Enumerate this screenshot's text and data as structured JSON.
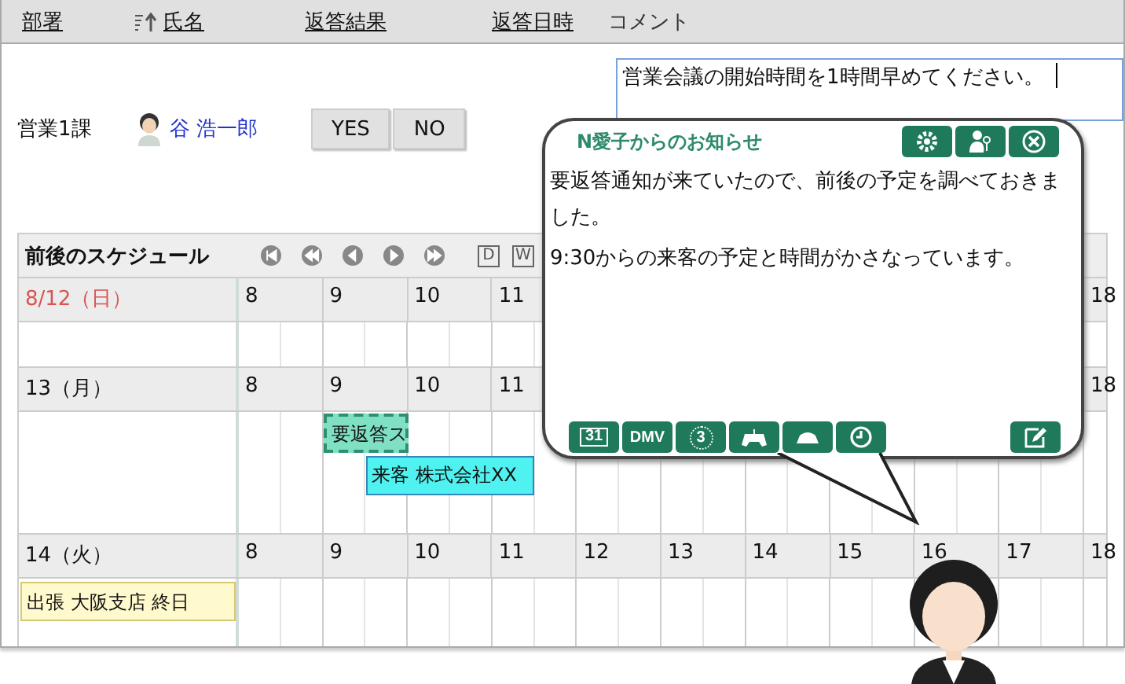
{
  "header_columns": [
    {
      "label": "部署",
      "kind": "link"
    },
    {
      "label": "氏名",
      "kind": "sorted"
    },
    {
      "label": "返答結果",
      "kind": "link"
    },
    {
      "label": "返答日時",
      "kind": "link"
    },
    {
      "label": "コメント",
      "kind": "plain"
    }
  ],
  "response_row": {
    "department": "営業1課",
    "name": "谷 浩一郎",
    "buttons": [
      "YES",
      "NO"
    ],
    "comment": "営業会議の開始時間を1時間早めてください。"
  },
  "schedule": {
    "title": "前後のスケジュール",
    "nav": [
      {
        "kind": "first"
      },
      {
        "kind": "fast-back"
      },
      {
        "kind": "back"
      },
      {
        "kind": "forward"
      },
      {
        "kind": "fast-forward"
      }
    ],
    "views": [
      {
        "label": "D"
      },
      {
        "label": "W"
      }
    ],
    "days": [
      {
        "label": "8/12（日）",
        "holiday": true,
        "hours": [
          "8",
          "9",
          "10",
          "11",
          "18"
        ]
      },
      {
        "label": "13（月）",
        "holiday": false,
        "hours": [
          "8",
          "9",
          "10",
          "11",
          "18"
        ],
        "events": [
          {
            "label": "要返答ス",
            "kind": "pending"
          },
          {
            "label": "来客 株式会社XX",
            "kind": "visitor"
          }
        ]
      },
      {
        "label": "14（火）",
        "holiday": false,
        "hours": [
          "8",
          "9",
          "10",
          "11",
          "12",
          "13",
          "14",
          "15",
          "16",
          "17",
          "18"
        ],
        "allday": [
          "出張 大阪支店 終日"
        ]
      }
    ]
  },
  "notice": {
    "title": "N愛子からのお知らせ",
    "header_buttons": [
      {
        "kind": "settings"
      },
      {
        "kind": "user"
      },
      {
        "kind": "close"
      }
    ],
    "paragraphs": [
      "要返答通知が来ていたので、前後の予定を調べておきました。",
      "9:30からの来客の予定と時間がかさなっています。"
    ],
    "tools": [
      {
        "kind": "calendar",
        "label": "31"
      },
      {
        "kind": "text",
        "label": "DMV"
      },
      {
        "kind": "counter",
        "label": "3"
      },
      {
        "kind": "gamepad"
      },
      {
        "kind": "bowl"
      },
      {
        "kind": "clock"
      }
    ]
  }
}
